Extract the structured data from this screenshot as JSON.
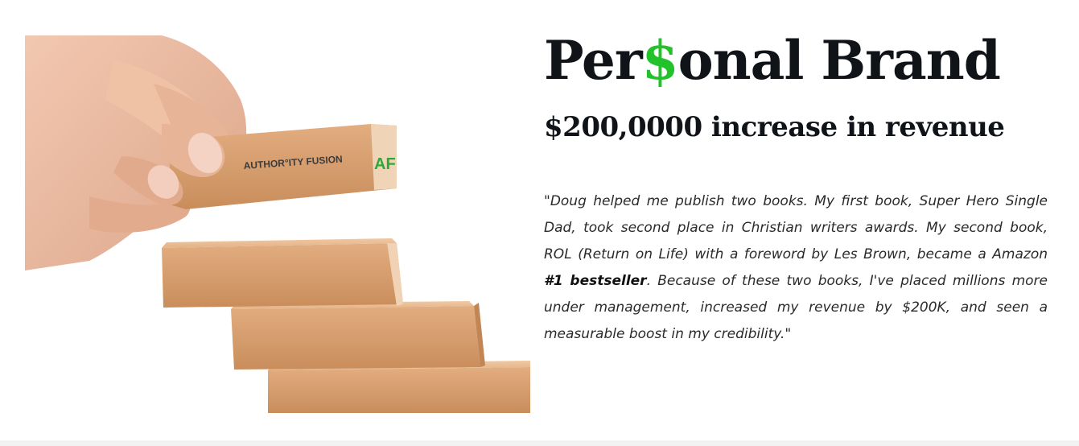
{
  "image": {
    "block_brand_text": "AUTHOR°ITY FUSION",
    "block_logo_text": "AF",
    "colors": {
      "wood": "#d9a274",
      "wood_dark": "#b9804f",
      "skin": "#e9b89d",
      "logo_green": "#2fa83a",
      "logo_dark": "#3b3b3b"
    }
  },
  "heading": {
    "title_part1": "Per",
    "title_accent": "$",
    "title_part2": "onal Brand",
    "subtitle": "$200,0000 increase in revenue",
    "accent_color": "#22c22a"
  },
  "testimonial": {
    "text_before_bold": "\"Doug helped me publish two books. My first book, Super Hero Single Dad, took second place in Christian writers awards. My second book, ROL (Return on Life) with a foreword by Les Brown, became a Amazon ",
    "bold": "#1 bestseller",
    "text_after_bold": ". Because of these two books, I've placed millions more under management, increased my revenue by $200K, and seen a measurable boost in my credibility.\""
  }
}
